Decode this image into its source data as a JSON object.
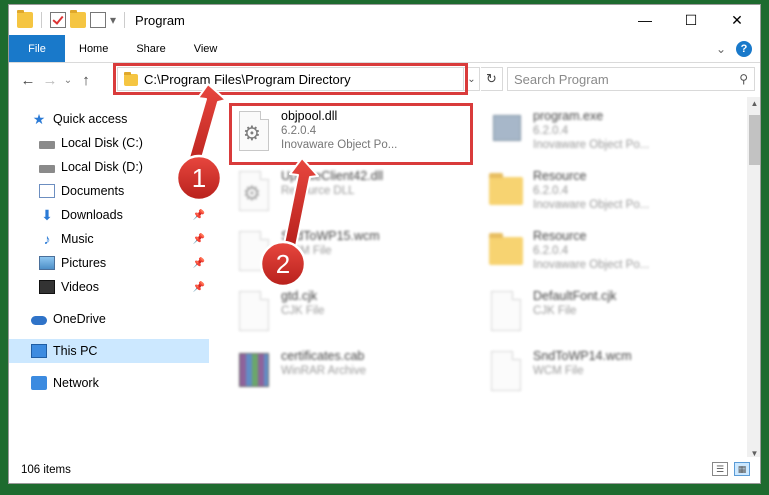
{
  "window": {
    "title": "Program",
    "controls": {
      "minimize": "—",
      "maximize": "☐",
      "close": "✕"
    }
  },
  "ribbon": {
    "tabs": [
      {
        "label": "File"
      },
      {
        "label": "Home"
      },
      {
        "label": "Share"
      },
      {
        "label": "View"
      }
    ],
    "help": "?"
  },
  "address": {
    "path": "C:\\Program Files\\Program Directory",
    "search_placeholder": "Search Program"
  },
  "nav": {
    "items": [
      {
        "label": "Quick access",
        "icon": "star-icon",
        "pinned": false
      },
      {
        "label": "Local Disk (C:)",
        "icon": "disk-icon",
        "pinned": true
      },
      {
        "label": "Local Disk (D:)",
        "icon": "disk-icon",
        "pinned": true
      },
      {
        "label": "Documents",
        "icon": "documents-icon",
        "pinned": true
      },
      {
        "label": "Downloads",
        "icon": "download-icon",
        "pinned": true
      },
      {
        "label": "Music",
        "icon": "music-icon",
        "pinned": true
      },
      {
        "label": "Pictures",
        "icon": "pictures-icon",
        "pinned": true
      },
      {
        "label": "Videos",
        "icon": "videos-icon",
        "pinned": true
      },
      {
        "label": "OneDrive",
        "icon": "onedrive-icon",
        "pinned": false
      },
      {
        "label": "This PC",
        "icon": "pc-icon",
        "pinned": false,
        "selected": true
      },
      {
        "label": "Network",
        "icon": "network-icon",
        "pinned": false
      }
    ]
  },
  "files": [
    {
      "name": "objpool.dll",
      "line1": "6.2.0.4",
      "line2": "Inovaware Object Po...",
      "icon": "dll-file-icon"
    },
    {
      "name": "program.exe",
      "line1": "6.2.0.4",
      "line2": "Inovaware Object Po...",
      "icon": "exe-file-icon"
    },
    {
      "name": "UpdateClient42.dll",
      "line1": "Resource DLL",
      "line2": "",
      "icon": "dll-file-icon"
    },
    {
      "name": "Resource",
      "line1": "6.2.0.4",
      "line2": "Inovaware Object Po...",
      "icon": "folder-icon"
    },
    {
      "name": "SndToWP15.wcm",
      "line1": "WCM File",
      "line2": "",
      "icon": "file-icon"
    },
    {
      "name": "Resource",
      "line1": "6.2.0.4",
      "line2": "Inovaware Object Po...",
      "icon": "folder-icon"
    },
    {
      "name": "gtd.cjk",
      "line1": "CJK File",
      "line2": "",
      "icon": "file-icon"
    },
    {
      "name": "DefaultFont.cjk",
      "line1": "CJK File",
      "line2": "",
      "icon": "file-icon"
    },
    {
      "name": "certificates.cab",
      "line1": "WinRAR Archive",
      "line2": "",
      "icon": "archive-icon"
    },
    {
      "name": "SndToWP14.wcm",
      "line1": "WCM File",
      "line2": "",
      "icon": "file-icon"
    }
  ],
  "status": {
    "count": "106 items"
  },
  "callouts": {
    "one": "1",
    "two": "2"
  },
  "colors": {
    "accent": "#1979ca",
    "highlight": "#d93b3b",
    "selection": "#cce8ff"
  }
}
